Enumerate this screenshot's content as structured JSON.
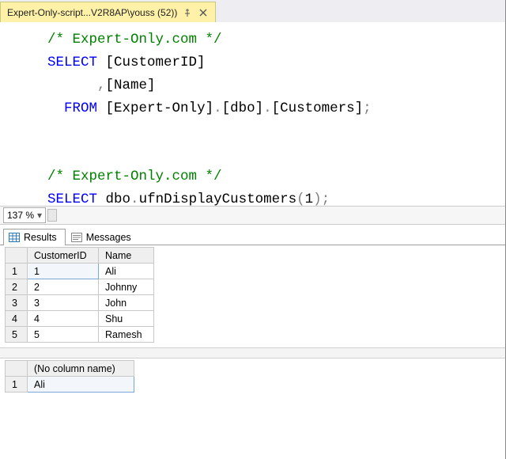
{
  "tab": {
    "title": "Expert-Only-script...V2R8AP\\youss (52))"
  },
  "editor": {
    "comment1": "/* Expert-Only.com */",
    "kw_select": "SELECT",
    "col1": "[CustomerID]",
    "comma_col2": ",[Name]",
    "kw_from": "FROM",
    "db": "[Expert-Only]",
    "dot": ".",
    "schema": "[dbo]",
    "table": "[Customers]",
    "semi": ";",
    "comment2": "/* Expert-Only.com */",
    "call_prefix": "dbo",
    "call_func": "ufnDisplayCustomers",
    "call_open": "(",
    "call_arg": "1",
    "call_close": ")",
    "call_semi": ";"
  },
  "zoom": {
    "value": "137 %"
  },
  "resultsTabs": {
    "results": "Results",
    "messages": "Messages"
  },
  "grid1": {
    "headers": {
      "id": "CustomerID",
      "name": "Name"
    },
    "rows": [
      {
        "n": "1",
        "id": "1",
        "name": "Ali"
      },
      {
        "n": "2",
        "id": "2",
        "name": "Johnny"
      },
      {
        "n": "3",
        "id": "3",
        "name": "John"
      },
      {
        "n": "4",
        "id": "4",
        "name": "Shu"
      },
      {
        "n": "5",
        "id": "5",
        "name": "Ramesh"
      }
    ]
  },
  "grid2": {
    "header": "(No column name)",
    "rows": [
      {
        "n": "1",
        "val": "Ali"
      }
    ]
  }
}
